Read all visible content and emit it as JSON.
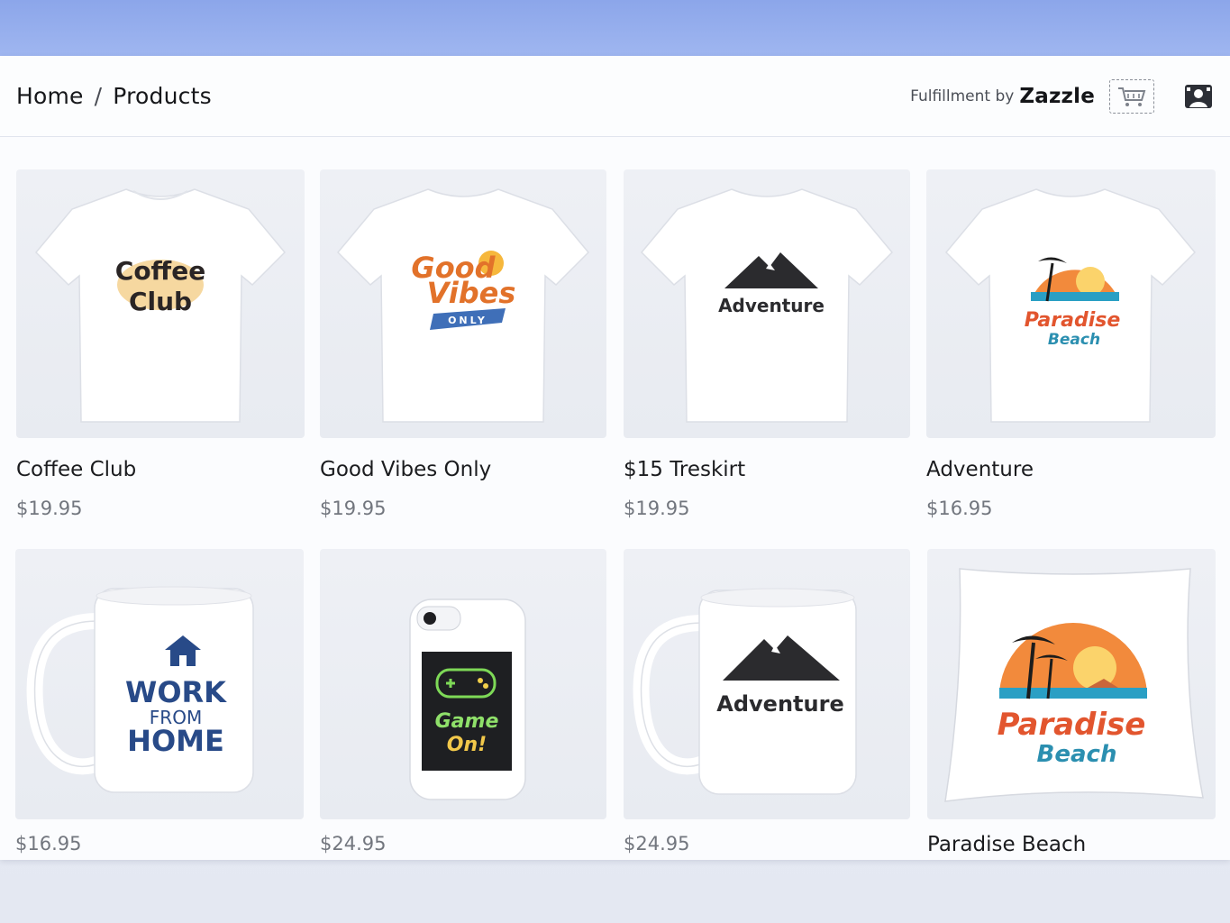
{
  "breadcrumb": {
    "home": "Home",
    "separator": "/",
    "current": "Products"
  },
  "header": {
    "fulfilment_label": "Fulfillment by",
    "brand": "Zazzle",
    "cart_icon": "cart-icon",
    "account_icon": "user-badge-icon"
  },
  "products": [
    {
      "name": "Coffee Club",
      "price": "$19.95",
      "kind": "t-shirt",
      "design_line1": "Coffee",
      "design_line2": "Club"
    },
    {
      "name": "Good Vibes Only",
      "price": "$19.95",
      "kind": "t-shirt",
      "design_line1": "Good",
      "design_line2": "Vibes",
      "design_line3": "ONLY"
    },
    {
      "name": "$15 Treskirt",
      "price": "$19.95",
      "kind": "t-shirt",
      "design_line1": "Adventure"
    },
    {
      "name": "Adventure",
      "price": "$16.95",
      "kind": "t-shirt",
      "design_line1": "Paradise",
      "design_line2": "Beach"
    },
    {
      "name": "",
      "price": "$16.95",
      "kind": "mug",
      "design_line1": "WORK",
      "design_line2": "FROM",
      "design_line3": "HOME"
    },
    {
      "name": "",
      "price": "$24.95",
      "kind": "phone-case",
      "design_line1": "Game",
      "design_line2": "On!"
    },
    {
      "name": "",
      "price": "$24.95",
      "kind": "mug",
      "design_line1": "Adventure"
    },
    {
      "name": "Paradise Beach",
      "price": "",
      "kind": "pillow",
      "design_line1": "Paradise",
      "design_line2": "Beach"
    }
  ]
}
